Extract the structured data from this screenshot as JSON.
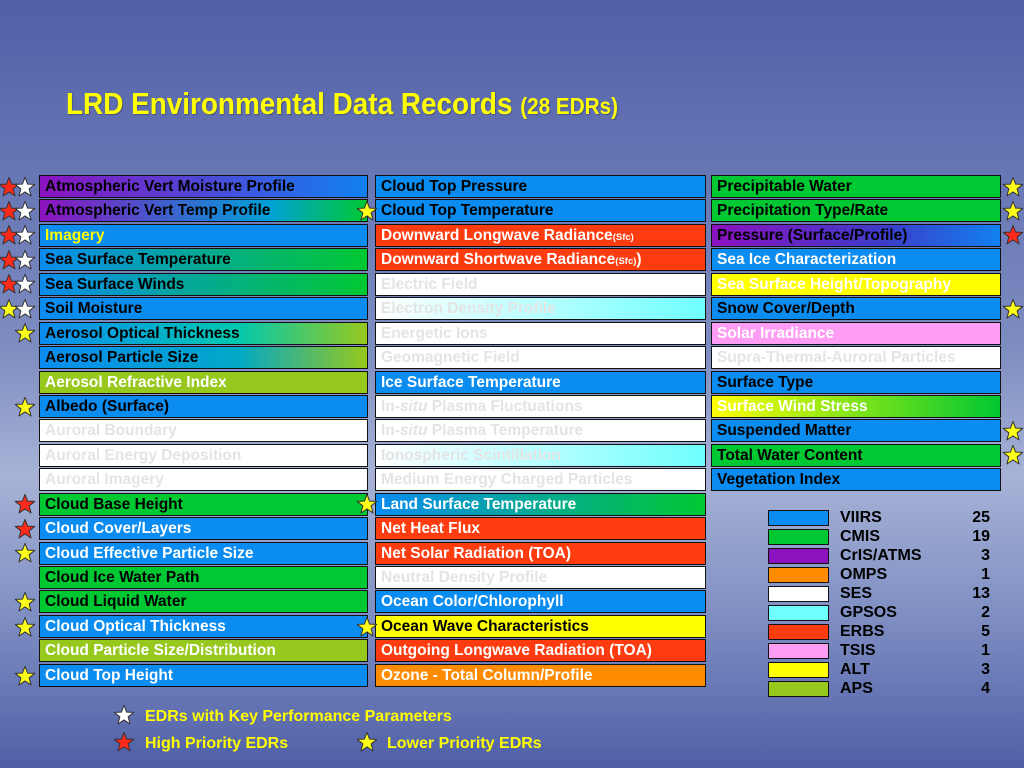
{
  "title": {
    "main": "LRD Environmental Data Records",
    "sub": "(28 EDRs)"
  },
  "colors": {
    "blue": "#0a8cf0",
    "green": "#00c832",
    "purple": "#8c12c0",
    "orange": "#ff8c00",
    "white": "#ffffff",
    "cyan": "#70ffff",
    "red": "#ff3c10",
    "pink": "#ff9cf4",
    "yellow": "#ffff00",
    "lime": "#96c81e"
  },
  "columns": [
    [
      {
        "text": "Atmospheric Vert Moisture Profile",
        "bg": "linear-gradient(90deg, #8c12c0 0%, #1080f0 100%)",
        "fg": "#000000"
      },
      {
        "text": "Atmospheric Vert Temp Profile",
        "bg": "linear-gradient(90deg, #8c12c0 0%, #00a0d8 70%, #00c832 100%)",
        "fg": "#000000"
      },
      {
        "text": "Imagery",
        "bg": "#0a8cf0",
        "fg": "#ffff00"
      },
      {
        "text": "Sea Surface Temperature",
        "bg": "linear-gradient(90deg, #0a8cf0 0%, #00c832 100%)",
        "fg": "#000000"
      },
      {
        "text": "Sea Surface Winds",
        "bg": "linear-gradient(90deg, #0a8cf0 0%, #00c832 100%)",
        "fg": "#000000"
      },
      {
        "text": "Soil Moisture",
        "bg": "#0a8cf0",
        "fg": "#000000"
      },
      {
        "text": "Aerosol Optical Thickness",
        "bg": "linear-gradient(90deg, #0a8cf0 0%, #00c8b0 60%, #96c81e 100%)",
        "fg": "#000000"
      },
      {
        "text": "Aerosol Particle Size",
        "bg": "linear-gradient(90deg, #0a8cf0 0%, #00a8c8 60%, #96c81e 100%)",
        "fg": "#000000"
      },
      {
        "text": "Aerosol Refractive Index",
        "bg": "#96c81e",
        "fg": "#ffffff"
      },
      {
        "text": "Albedo (Surface)",
        "bg": "#0a8cf0",
        "fg": "#000000"
      },
      {
        "text": "Auroral Boundary",
        "bg": "#ffffff",
        "fg": "#e4e4e4"
      },
      {
        "text": "Auroral Energy Deposition",
        "bg": "#ffffff",
        "fg": "#e4e4e4"
      },
      {
        "text": "Auroral Imagery",
        "bg": "#ffffff",
        "fg": "#e4e4e4"
      },
      {
        "text": "Cloud Base Height",
        "bg": "#00c832",
        "fg": "#000000"
      },
      {
        "text": "Cloud Cover/Layers",
        "bg": "#0a8cf0",
        "fg": "#ffffff"
      },
      {
        "text": "Cloud Effective Particle Size",
        "bg": "#0a8cf0",
        "fg": "#ffffff"
      },
      {
        "text": "Cloud Ice Water Path",
        "bg": "#00c832",
        "fg": "#000000"
      },
      {
        "text": "Cloud Liquid Water",
        "bg": "#00c832",
        "fg": "#000000"
      },
      {
        "text": "Cloud Optical Thickness",
        "bg": "#0a8cf0",
        "fg": "#ffffff"
      },
      {
        "text": "Cloud Particle Size/Distribution",
        "bg": "#96c81e",
        "fg": "#ffffff"
      },
      {
        "text": "Cloud Top Height",
        "bg": "#0a8cf0",
        "fg": "#ffffff"
      }
    ],
    [
      {
        "text": "Cloud Top Pressure",
        "bg": "#0a8cf0",
        "fg": "#000000"
      },
      {
        "text": "Cloud Top Temperature",
        "bg": "#0a8cf0",
        "fg": "#000000"
      },
      {
        "text": "Downward Longwave Radiance",
        "suffix": "(Sfc)",
        "bg": "#ff3c10",
        "fg": "#ffffff"
      },
      {
        "text": "Downward Shortwave  Radiance",
        "suffix": "(Sfc)",
        "tail": ")",
        "bg": "#ff3c10",
        "fg": "#ffffff"
      },
      {
        "text": "Electric Field",
        "bg": "#ffffff",
        "fg": "#e4e4e4"
      },
      {
        "text": "Electron Density Profile",
        "bg": "linear-gradient(90deg, #ffffff 0%, #70ffff 100%)",
        "fg": "#e4e4e4"
      },
      {
        "text": "Energetic Ions",
        "bg": "#ffffff",
        "fg": "#e4e4e4"
      },
      {
        "text": "Geomagnetic Field",
        "bg": "#ffffff",
        "fg": "#e4e4e4"
      },
      {
        "text": "Ice Surface Temperature",
        "bg": "#0a8cf0",
        "fg": "#ffffff"
      },
      {
        "text": "In-",
        "italic": "situ",
        "rest": " Plasma Fluctuations",
        "bg": "#ffffff",
        "fg": "#e4e4e4"
      },
      {
        "text": "In-",
        "italic": "situ",
        "rest": " Plasma Temperature",
        "bg": "#ffffff",
        "fg": "#e4e4e4"
      },
      {
        "text": "Ionospheric Scintillation",
        "bg": "linear-gradient(90deg, #ffffff 0%, #70ffff 100%)",
        "fg": "#e4e4e4"
      },
      {
        "text": "Medium Energy Charged Particles",
        "bg": "#ffffff",
        "fg": "#e4e4e4"
      },
      {
        "text": "Land Surface Temperature",
        "bg": "linear-gradient(90deg, #0a8cf0 0%, #00c832 100%)",
        "fg": "#ffffff"
      },
      {
        "text": "Net Heat Flux",
        "bg": "#ff3c10",
        "fg": "#ffffff"
      },
      {
        "text": "Net Solar Radiation (TOA)",
        "bg": "#ff3c10",
        "fg": "#ffffff"
      },
      {
        "text": "Neutral Density Profile",
        "bg": "#ffffff",
        "fg": "#e4e4e4"
      },
      {
        "text": "Ocean Color/Chlorophyll",
        "bg": "#0a8cf0",
        "fg": "#ffffff"
      },
      {
        "text": "Ocean Wave Characteristics",
        "bg": "#ffff00",
        "fg": "#000000"
      },
      {
        "text": "Outgoing Longwave Radiation (TOA)",
        "bg": "#ff3c10",
        "fg": "#ffffff"
      },
      {
        "text": "Ozone - Total Column/Profile",
        "bg": "#ff8c00",
        "fg": "#ffffff"
      }
    ],
    [
      {
        "text": "Precipitable Water",
        "bg": "#00c832",
        "fg": "#000000"
      },
      {
        "text": "Precipitation Type/Rate",
        "bg": "#00c832",
        "fg": "#000000"
      },
      {
        "text": "Pressure (Surface/Profile)",
        "bg": "linear-gradient(90deg, #8c12c0 0%, #3c3cc8 60%, #1080f0 100%)",
        "fg": "#000000"
      },
      {
        "text": "Sea Ice Characterization",
        "bg": "#0a8cf0",
        "fg": "#ffffff"
      },
      {
        "text": "Sea Surface Height/Topography",
        "bg": "#ffff00",
        "fg": "#ffffff"
      },
      {
        "text": "Snow Cover/Depth",
        "bg": "#0a8cf0",
        "fg": "#000000"
      },
      {
        "text": "Solar Irradiance",
        "bg": "#ff9cf4",
        "fg": "#ffffff"
      },
      {
        "text": "Supra-Thermal-Auroral Particles",
        "bg": "#ffffff",
        "fg": "#e4e4e4"
      },
      {
        "text": "Surface Type",
        "bg": "#0a8cf0",
        "fg": "#000000"
      },
      {
        "text": "Surface Wind Stress",
        "bg": "linear-gradient(90deg, #ffff00 0%, #00c832 100%)",
        "fg": "#ffffff"
      },
      {
        "text": "Suspended Matter",
        "bg": "#0a8cf0",
        "fg": "#000000"
      },
      {
        "text": "Total Water Content",
        "bg": "#00c832",
        "fg": "#000000"
      },
      {
        "text": "Vegetation Index",
        "bg": "#0a8cf0",
        "fg": "#000000"
      }
    ]
  ],
  "legend": [
    {
      "name": "VIIRS",
      "count": "25",
      "color": "#0a8cf0"
    },
    {
      "name": "CMIS",
      "count": "19",
      "color": "#00c832"
    },
    {
      "name": "CrIS/ATMS",
      "count": "3",
      "color": "#8c12c0"
    },
    {
      "name": "OMPS",
      "count": "1",
      "color": "#ff8c00"
    },
    {
      "name": "SES",
      "count": "13",
      "color": "#ffffff"
    },
    {
      "name": "GPSOS",
      "count": "2",
      "color": "#70ffff"
    },
    {
      "name": "ERBS",
      "count": "5",
      "color": "#ff3c10"
    },
    {
      "name": "TSIS",
      "count": "1",
      "color": "#ff9cf4"
    },
    {
      "name": "ALT",
      "count": "3",
      "color": "#ffff00"
    },
    {
      "name": "APS",
      "count": "4",
      "color": "#96c81e"
    }
  ],
  "key": {
    "kpp_label": "EDRs with Key Performance Parameters",
    "high_label": "High Priority EDRs",
    "low_label": "Lower Priority EDRs"
  },
  "stars": {
    "col1": [
      [
        "red",
        "white"
      ],
      [
        "red",
        "white"
      ],
      [
        "red",
        "white"
      ],
      [
        "red",
        "white"
      ],
      [
        "red",
        "white"
      ],
      [
        "yellow",
        "white"
      ],
      [
        "yellow"
      ],
      [],
      [],
      [
        "yellow"
      ],
      [],
      [],
      [],
      [
        "red"
      ],
      [
        "red"
      ],
      [
        "yellow"
      ],
      [],
      [
        "yellow"
      ],
      [
        "yellow"
      ],
      [],
      [
        "yellow"
      ]
    ],
    "col2": [
      [],
      [
        "yellow"
      ],
      [],
      [],
      [],
      [],
      [],
      [],
      [],
      [],
      [],
      [],
      [],
      [
        "yellow"
      ],
      [],
      [],
      [],
      [],
      [
        "yellow"
      ],
      [],
      []
    ],
    "col3": [
      [
        "yellow"
      ],
      [
        "yellow"
      ],
      [
        "red"
      ],
      [],
      [],
      [
        "yellow"
      ],
      [],
      [],
      [],
      [],
      [
        "yellow"
      ],
      [
        "yellow"
      ],
      []
    ]
  }
}
